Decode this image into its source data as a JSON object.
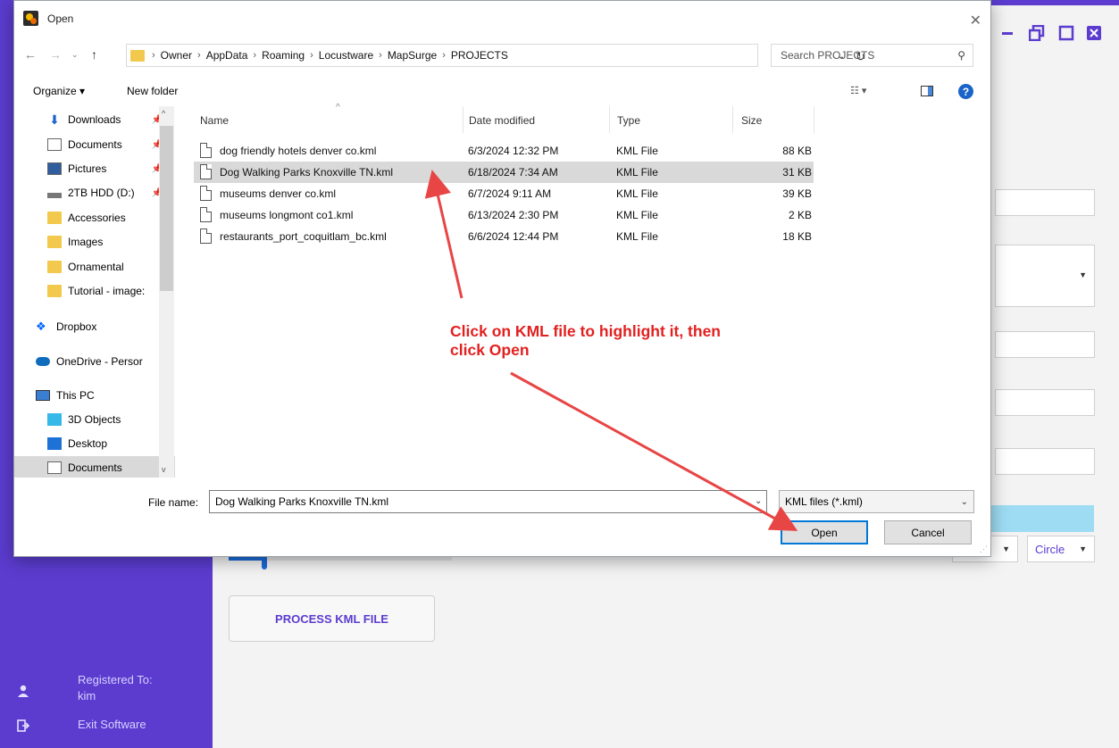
{
  "app": {
    "registered_label": "Registered To:",
    "registered_user": "kim",
    "exit_label": "Exit Software",
    "process_button": "PROCESS KML FILE",
    "shape_select": "Circle",
    "minimize_icon": "minimize-icon",
    "restore_icon": "restore-icon",
    "maximize_icon": "maximize-icon",
    "close_icon": "close-icon",
    "accent_color": "#5b3ccf"
  },
  "dialog": {
    "title": "Open",
    "breadcrumb": [
      "Owner",
      "AppData",
      "Roaming",
      "Locustware",
      "MapSurge",
      "PROJECTS"
    ],
    "search_placeholder": "Search PROJECTS",
    "organize_label": "Organize ▾",
    "new_folder_label": "New folder",
    "nav_items": [
      {
        "label": "Downloads",
        "icon": "download-icon",
        "pinned": true
      },
      {
        "label": "Documents",
        "icon": "document-icon",
        "pinned": true
      },
      {
        "label": "Pictures",
        "icon": "pictures-icon",
        "pinned": true
      },
      {
        "label": "2TB HDD (D:)",
        "icon": "drive-icon",
        "pinned": true
      },
      {
        "label": "Accessories",
        "icon": "folder-icon"
      },
      {
        "label": "Images",
        "icon": "folder-icon"
      },
      {
        "label": "Ornamental",
        "icon": "folder-icon"
      },
      {
        "label": "Tutorial - image:",
        "icon": "folder-icon"
      },
      {
        "label": "Dropbox",
        "icon": "dropbox-icon"
      },
      {
        "label": "OneDrive - Persor",
        "icon": "onedrive-icon"
      },
      {
        "label": "This PC",
        "icon": "computer-icon"
      },
      {
        "label": "3D Objects",
        "icon": "cube-icon"
      },
      {
        "label": "Desktop",
        "icon": "desktop-icon"
      },
      {
        "label": "Documents",
        "icon": "document-icon",
        "selected": true
      }
    ],
    "columns": {
      "name": "Name",
      "date": "Date modified",
      "type": "Type",
      "size": "Size"
    },
    "files": [
      {
        "name": "dog friendly hotels denver co.kml",
        "date": "6/3/2024 12:32 PM",
        "type": "KML File",
        "size": "88 KB"
      },
      {
        "name": "Dog Walking Parks Knoxville TN.kml",
        "date": "6/18/2024 7:34 AM",
        "type": "KML File",
        "size": "31 KB",
        "selected": true
      },
      {
        "name": "museums denver co.kml",
        "date": "6/7/2024 9:11 AM",
        "type": "KML File",
        "size": "39 KB"
      },
      {
        "name": "museums longmont co1.kml",
        "date": "6/13/2024 2:30 PM",
        "type": "KML File",
        "size": "2 KB"
      },
      {
        "name": "restaurants_port_coquitlam_bc.kml",
        "date": "6/6/2024 12:44 PM",
        "type": "KML File",
        "size": "18 KB"
      }
    ],
    "file_name_label": "File name:",
    "file_name_value": "Dog Walking Parks Knoxville TN.kml",
    "file_type_value": "KML files (*.kml)",
    "open_label": "Open",
    "cancel_label": "Cancel"
  },
  "annotation": {
    "line1": "Click on KML file to highlight it, then",
    "line2": "click Open",
    "color": "#e32020"
  }
}
